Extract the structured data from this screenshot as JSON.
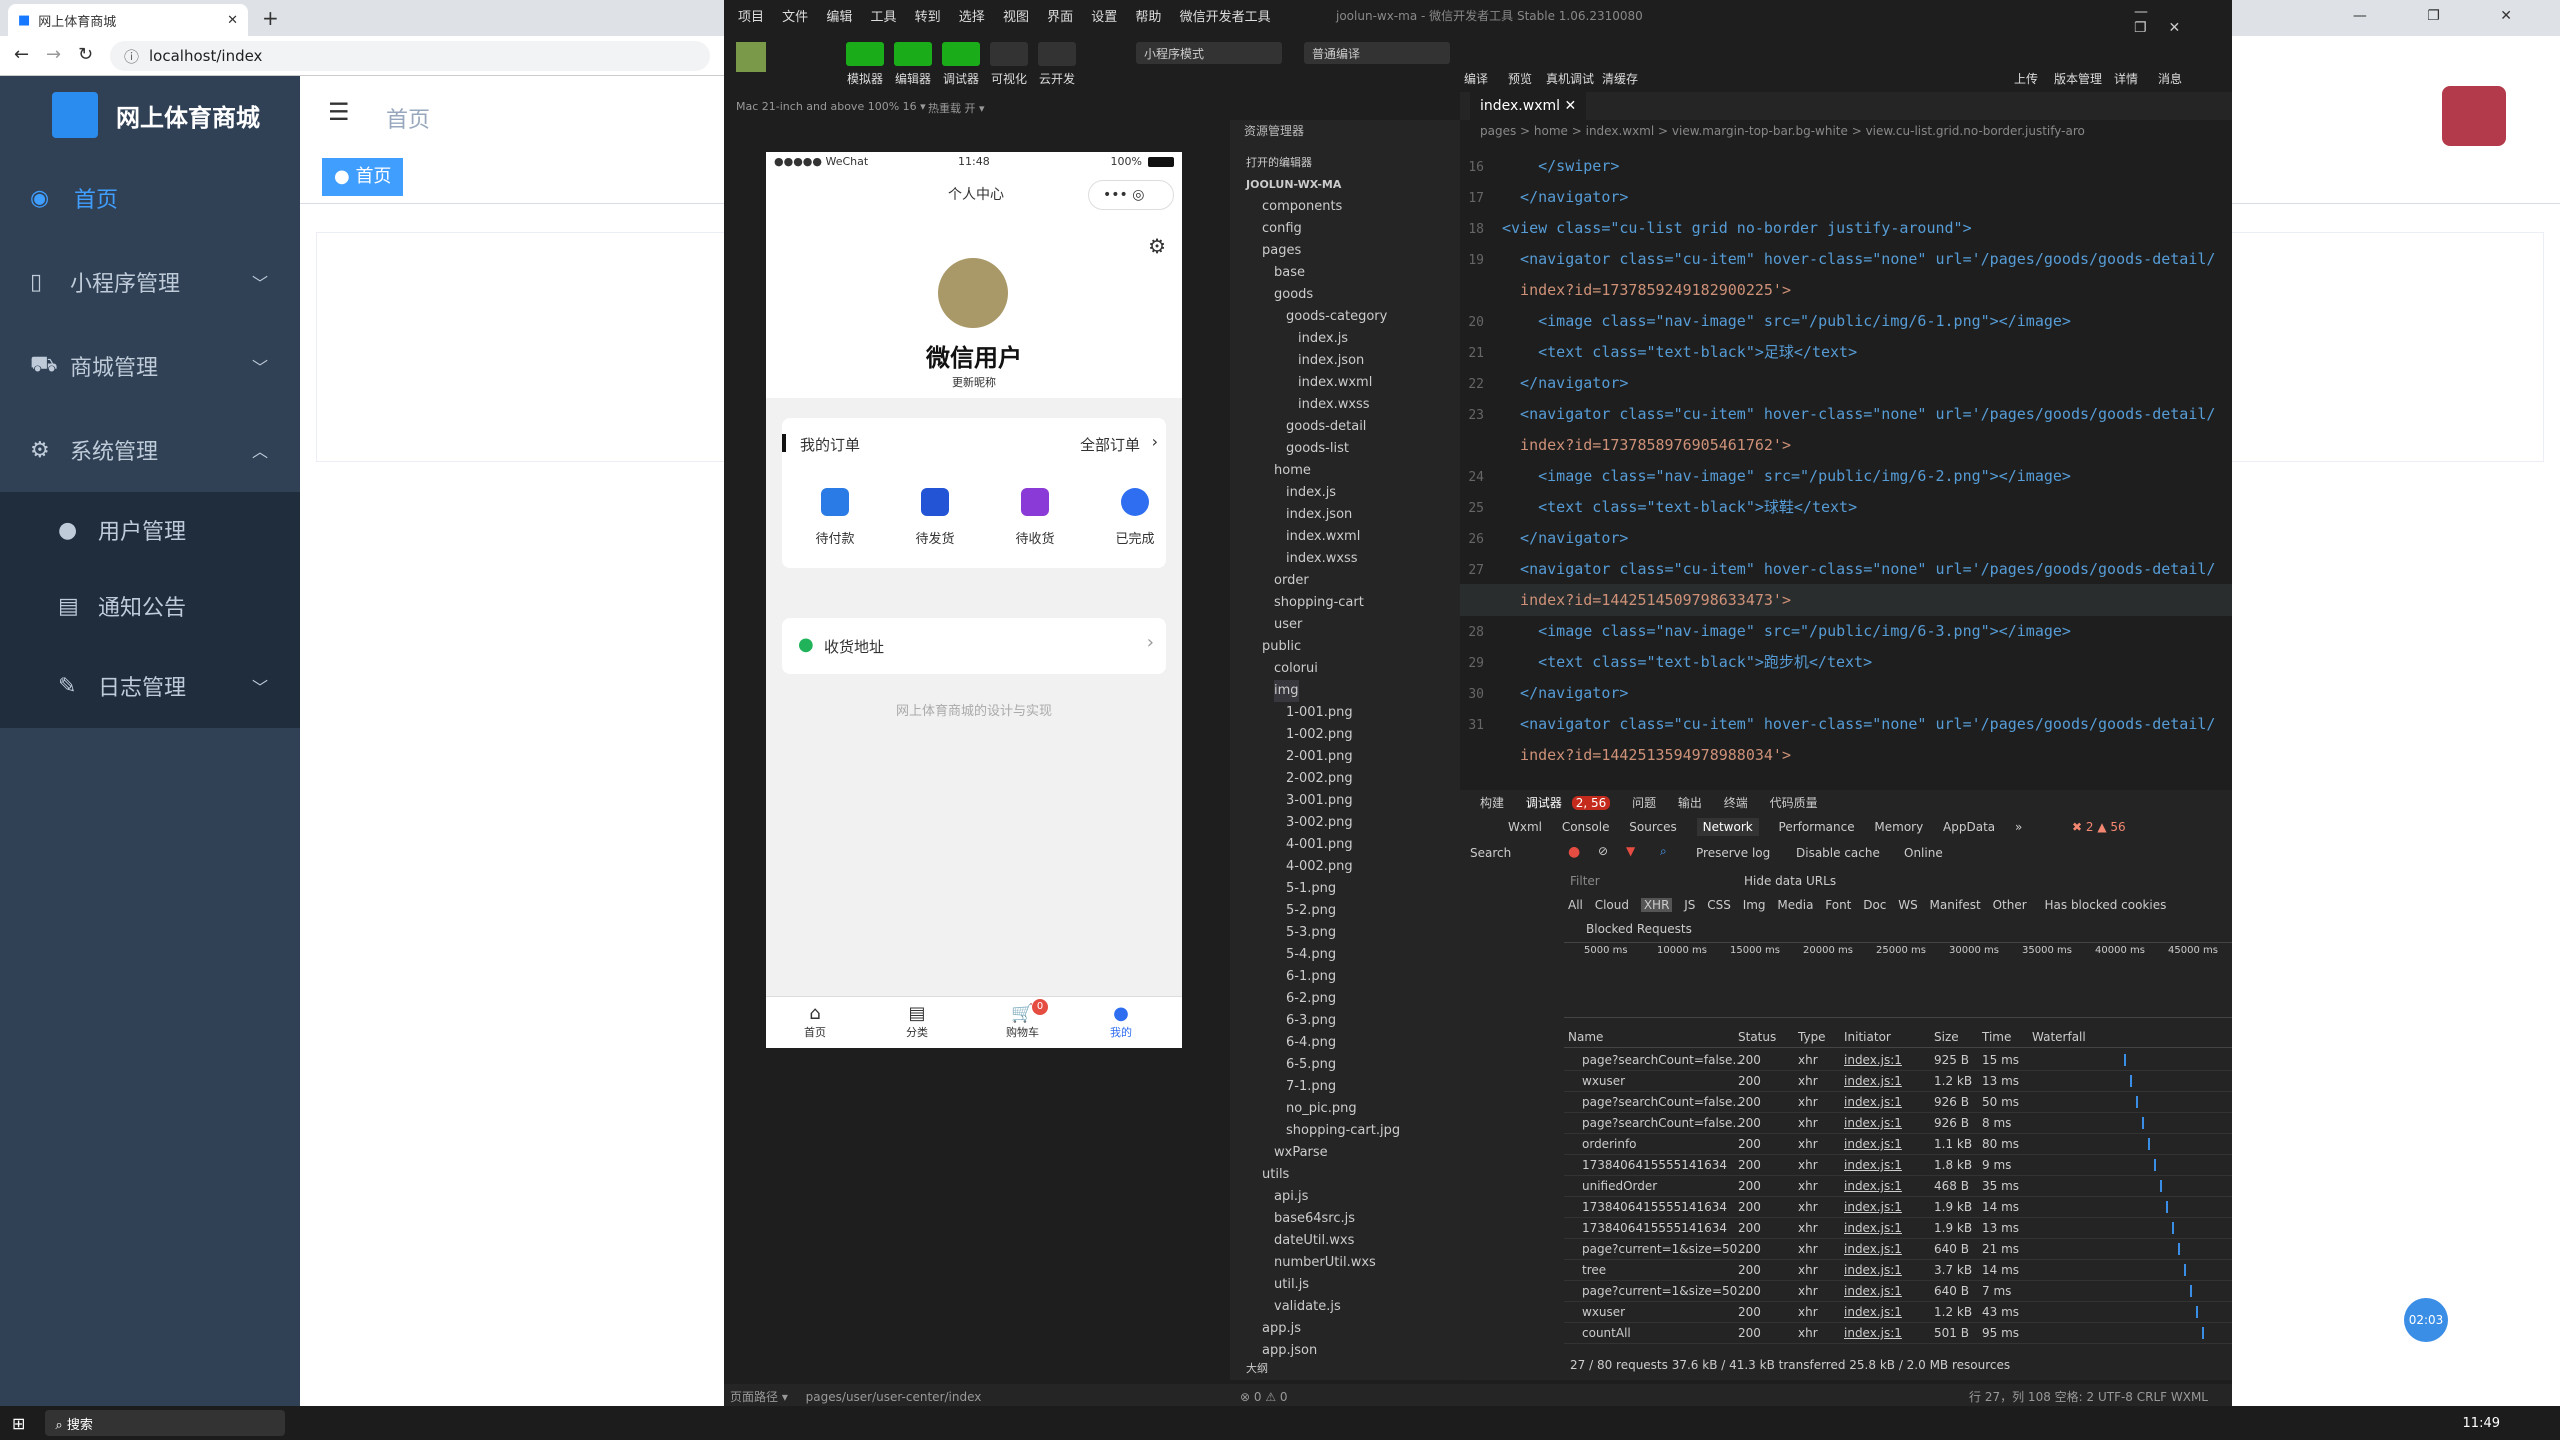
{
  "browser": {
    "tab_title": "网上体育商城",
    "tab_close": "✕",
    "new_tab": "+",
    "url": "localhost/index"
  },
  "admin": {
    "logo_text": "网上体育商城",
    "menu": [
      {
        "label": "首页"
      },
      {
        "label": "小程序管理"
      },
      {
        "label": "商城管理"
      },
      {
        "label": "系统管理"
      },
      {
        "label": "用户管理"
      },
      {
        "label": "通知公告"
      },
      {
        "label": "日志管理"
      }
    ],
    "breadcrumb": "首页",
    "tag": "首页",
    "float_badge": "02:03"
  },
  "devtools": {
    "title": "joolun-wx-ma - 微信开发者工具 Stable 1.06.2310080",
    "menus": [
      "项目",
      "文件",
      "编辑",
      "工具",
      "转到",
      "选择",
      "视图",
      "界面",
      "设置",
      "帮助",
      "微信开发者工具"
    ],
    "toolbar": {
      "simulator": "模拟器",
      "editor": "编辑器",
      "debugger": "调试器",
      "visual": "可视化",
      "cloud": "云开发",
      "mode": "小程序模式",
      "compile_mode": "普通编译",
      "compile": "编译",
      "preview": "预览",
      "real_debug": "真机调试",
      "clear_cache": "清缓存",
      "upload": "上传",
      "version": "版本管理",
      "details": "详情",
      "messages": "消息"
    },
    "device": "Mac 21-inch and above 100% 16 ▾",
    "hotreload": "热重载 开 ▾",
    "explorer_title": "资源管理器",
    "open_editors": "打开的编辑器",
    "project": "JOOLUN-WX-MA",
    "files": [
      "components",
      "config",
      "pages",
      "base",
      "goods",
      "goods-category",
      "index.js",
      "index.json",
      "index.wxml",
      "index.wxss",
      "goods-detail",
      "goods-list",
      "home",
      "index.js",
      "index.json",
      "index.wxml",
      "index.wxss",
      "order",
      "shopping-cart",
      "user",
      "public",
      "colorui",
      "img",
      "1-001.png",
      "1-002.png",
      "2-001.png",
      "2-002.png",
      "3-001.png",
      "3-002.png",
      "4-001.png",
      "4-002.png",
      "5-1.png",
      "5-2.png",
      "5-3.png",
      "5-4.png",
      "6-1.png",
      "6-2.png",
      "6-3.png",
      "6-4.png",
      "6-5.png",
      "7-1.png",
      "no_pic.png",
      "shopping-cart.jpg",
      "wxParse",
      "utils",
      "api.js",
      "base64src.js",
      "dateUtil.wxs",
      "numberUtil.wxs",
      "util.js",
      "validate.js",
      "app.js",
      "app.json"
    ],
    "outline": "大纲",
    "editor_tab": "index.wxml",
    "crumbs": "pages > home > index.wxml > view.margin-top-bar.bg-white > view.cu-list.grid.no-border.justify-aro",
    "code": [
      {
        "n": "16",
        "t": "    </swiper>"
      },
      {
        "n": "17",
        "t": "  </navigator>"
      },
      {
        "n": "18",
        "t": "<view class=\"cu-list grid no-border justify-around\">"
      },
      {
        "n": "19",
        "t": "  <navigator class=\"cu-item\" hover-class=\"none\" url='/pages/goods/goods-detail/"
      },
      {
        "n": "",
        "t": "  index?id=1737859249182900225'>"
      },
      {
        "n": "20",
        "t": "    <image class=\"nav-image\" src=\"/public/img/6-1.png\"></image>"
      },
      {
        "n": "21",
        "t": "    <text class=\"text-black\">足球</text>"
      },
      {
        "n": "22",
        "t": "  </navigator>"
      },
      {
        "n": "23",
        "t": "  <navigator class=\"cu-item\" hover-class=\"none\" url='/pages/goods/goods-detail/"
      },
      {
        "n": "",
        "t": "  index?id=1737858976905461762'>"
      },
      {
        "n": "24",
        "t": "    <image class=\"nav-image\" src=\"/public/img/6-2.png\"></image>"
      },
      {
        "n": "25",
        "t": "    <text class=\"text-black\">球鞋</text>"
      },
      {
        "n": "26",
        "t": "  </navigator>"
      },
      {
        "n": "27",
        "t": "  <navigator class=\"cu-item\" hover-class=\"none\" url='/pages/goods/goods-detail/"
      },
      {
        "n": "",
        "t": "  index?id=1442514509798633473'>"
      },
      {
        "n": "28",
        "t": "    <image class=\"nav-image\" src=\"/public/img/6-3.png\"></image>"
      },
      {
        "n": "29",
        "t": "    <text class=\"text-black\">跑步机</text>"
      },
      {
        "n": "30",
        "t": "  </navigator>"
      },
      {
        "n": "31",
        "t": "  <navigator class=\"cu-item\" hover-class=\"none\" url='/pages/goods/goods-detail/"
      },
      {
        "n": "",
        "t": "  index?id=1442513594978988034'>"
      }
    ],
    "panel_tabs": [
      "构建",
      "调试器",
      "2, 56",
      "问题",
      "输出",
      "终端",
      "代码质量"
    ],
    "devtabs": [
      "Wxml",
      "Console",
      "Sources",
      "Network",
      "Performance",
      "Memory",
      "AppData",
      "»"
    ],
    "err_warn": "✖ 2 ▲ 56",
    "search": "Search",
    "preserve_log": "Preserve log",
    "disable_cache": "Disable cache",
    "online": "Online",
    "filter": "Filter",
    "hide_data_urls": "Hide data URLs",
    "filter_types": [
      "All",
      "Cloud",
      "XHR",
      "JS",
      "CSS",
      "Img",
      "Media",
      "Font",
      "Doc",
      "WS",
      "Manifest",
      "Other"
    ],
    "blocked_cookies": "Has blocked cookies",
    "blocked_requests": "Blocked Requests",
    "timeline": [
      "5000 ms",
      "10000 ms",
      "15000 ms",
      "20000 ms",
      "25000 ms",
      "30000 ms",
      "35000 ms",
      "40000 ms",
      "45000 ms"
    ],
    "columns": [
      "Name",
      "Status",
      "Type",
      "Initiator",
      "Size",
      "Time",
      "Waterfall"
    ],
    "rows": [
      {
        "name": "page?searchCount=false...",
        "status": "200",
        "type": "xhr",
        "init": "index.js:1",
        "size": "925 B",
        "time": "15 ms"
      },
      {
        "name": "wxuser",
        "status": "200",
        "type": "xhr",
        "init": "index.js:1",
        "size": "1.2 kB",
        "time": "13 ms"
      },
      {
        "name": "page?searchCount=false...",
        "status": "200",
        "type": "xhr",
        "init": "index.js:1",
        "size": "926 B",
        "time": "50 ms"
      },
      {
        "name": "page?searchCount=false...",
        "status": "200",
        "type": "xhr",
        "init": "index.js:1",
        "size": "926 B",
        "time": "8 ms"
      },
      {
        "name": "orderinfo",
        "status": "200",
        "type": "xhr",
        "init": "index.js:1",
        "size": "1.1 kB",
        "time": "80 ms"
      },
      {
        "name": "1738406415555141634",
        "status": "200",
        "type": "xhr",
        "init": "index.js:1",
        "size": "1.8 kB",
        "time": "9 ms"
      },
      {
        "name": "unifiedOrder",
        "status": "200",
        "type": "xhr",
        "init": "index.js:1",
        "size": "468 B",
        "time": "35 ms"
      },
      {
        "name": "1738406415555141634",
        "status": "200",
        "type": "xhr",
        "init": "index.js:1",
        "size": "1.9 kB",
        "time": "14 ms"
      },
      {
        "name": "1738406415555141634",
        "status": "200",
        "type": "xhr",
        "init": "index.js:1",
        "size": "1.9 kB",
        "time": "13 ms"
      },
      {
        "name": "page?current=1&size=50...",
        "status": "200",
        "type": "xhr",
        "init": "index.js:1",
        "size": "640 B",
        "time": "21 ms"
      },
      {
        "name": "tree",
        "status": "200",
        "type": "xhr",
        "init": "index.js:1",
        "size": "3.7 kB",
        "time": "14 ms"
      },
      {
        "name": "page?current=1&size=50...",
        "status": "200",
        "type": "xhr",
        "init": "index.js:1",
        "size": "640 B",
        "time": "7 ms"
      },
      {
        "name": "wxuser",
        "status": "200",
        "type": "xhr",
        "init": "index.js:1",
        "size": "1.2 kB",
        "time": "43 ms"
      },
      {
        "name": "countAll",
        "status": "200",
        "type": "xhr",
        "init": "index.js:1",
        "size": "501 B",
        "time": "95 ms"
      }
    ],
    "summary": "27 / 80 requests   37.6 kB / 41.3 kB transferred   25.8 kB / 2.0 MB resources",
    "status_left": "页面路径 ▾",
    "status_path": "pages/user/user-center/index",
    "status_errors": "⊗ 0 ⚠ 0",
    "status_right": "行 27，列 108   空格: 2   UTF-8   CRLF   WXML"
  },
  "phone": {
    "carrier": "●●●●● WeChat",
    "time": "11:48",
    "battery": "100%",
    "title": "个人中心",
    "user_name": "微信用户",
    "update_nick": "更新昵称",
    "orders_title": "我的订单",
    "all_orders": "全部订单",
    "order_items": [
      "待付款",
      "待发货",
      "待收货",
      "已完成"
    ],
    "address": "收货地址",
    "footer": "网上体育商城的设计与实现",
    "tabs": [
      "首页",
      "分类",
      "购物车",
      "我的"
    ],
    "cart_badge": "0"
  },
  "taskbar": {
    "search": "搜索",
    "clock": "11:49"
  }
}
